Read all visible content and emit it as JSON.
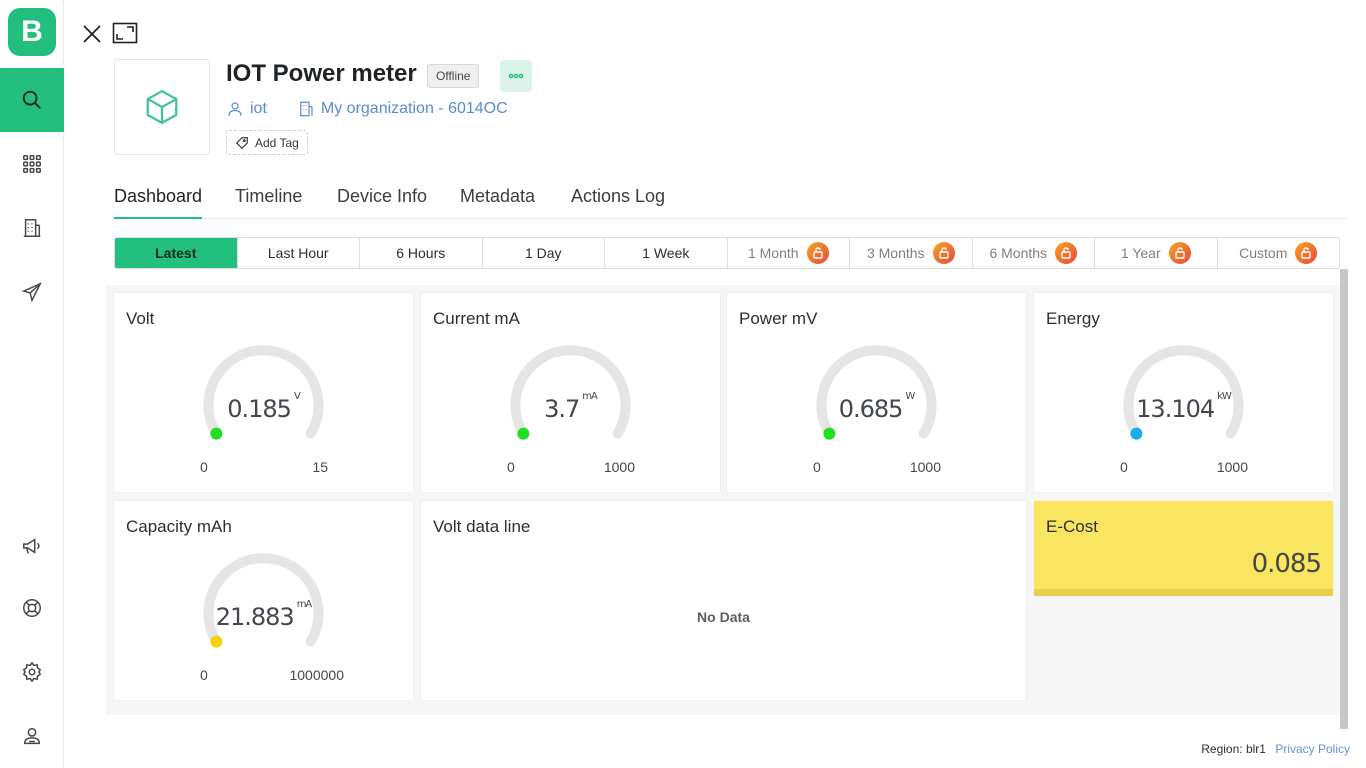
{
  "sidebar": {
    "logo_letter": "B",
    "items": [
      {
        "name": "search-icon"
      },
      {
        "name": "apps-grid-icon"
      },
      {
        "name": "organization-building-icon"
      },
      {
        "name": "send-icon"
      },
      {
        "name": "megaphone-icon"
      },
      {
        "name": "help-lifebuoy-icon"
      },
      {
        "name": "settings-gear-icon"
      },
      {
        "name": "user-profile-icon"
      }
    ],
    "accent": "#23bf7f"
  },
  "device": {
    "title": "IOT Power meter",
    "status": "Offline",
    "owner": "iot",
    "organization": "My organization - 6014OC",
    "add_tag": "Add Tag"
  },
  "tabs": [
    "Dashboard",
    "Timeline",
    "Device Info",
    "Metadata",
    "Actions Log"
  ],
  "ranges": [
    {
      "label": "Latest",
      "active": true,
      "locked": false
    },
    {
      "label": "Last Hour",
      "locked": false
    },
    {
      "label": "6 Hours",
      "locked": false
    },
    {
      "label": "1 Day",
      "locked": false
    },
    {
      "label": "1 Week",
      "locked": false
    },
    {
      "label": "1 Month",
      "locked": true
    },
    {
      "label": "3 Months",
      "locked": true
    },
    {
      "label": "6 Months",
      "locked": true
    },
    {
      "label": "1 Year",
      "locked": true
    },
    {
      "label": "Custom",
      "locked": true
    }
  ],
  "widgets": {
    "volt": {
      "title": "Volt",
      "value": "0.185",
      "unit": "V",
      "min": "0",
      "max": "15",
      "dot_color": "#1fe01f"
    },
    "current": {
      "title": "Current mA",
      "value": "3.7",
      "unit": "mA",
      "min": "0",
      "max": "1000",
      "dot_color": "#1fe01f"
    },
    "power": {
      "title": "Power mV",
      "value": "0.685",
      "unit": "W",
      "min": "0",
      "max": "1000",
      "dot_color": "#1fe01f"
    },
    "energy": {
      "title": "Energy",
      "value": "13.104",
      "unit": "kW",
      "min": "0",
      "max": "1000",
      "dot_color": "#1aaee8"
    },
    "capacity": {
      "title": "Capacity mAh",
      "value": "21.883",
      "unit": "mA",
      "min": "0",
      "max": "1000000",
      "dot_color": "#f5d20a"
    },
    "volt_line": {
      "title": "Volt data line",
      "empty_text": "No Data"
    },
    "ecost": {
      "title": "E-Cost",
      "value": "0.085",
      "color": "#f9e560"
    }
  },
  "footer": {
    "region": "Region: blr1",
    "privacy": "Privacy Policy"
  }
}
